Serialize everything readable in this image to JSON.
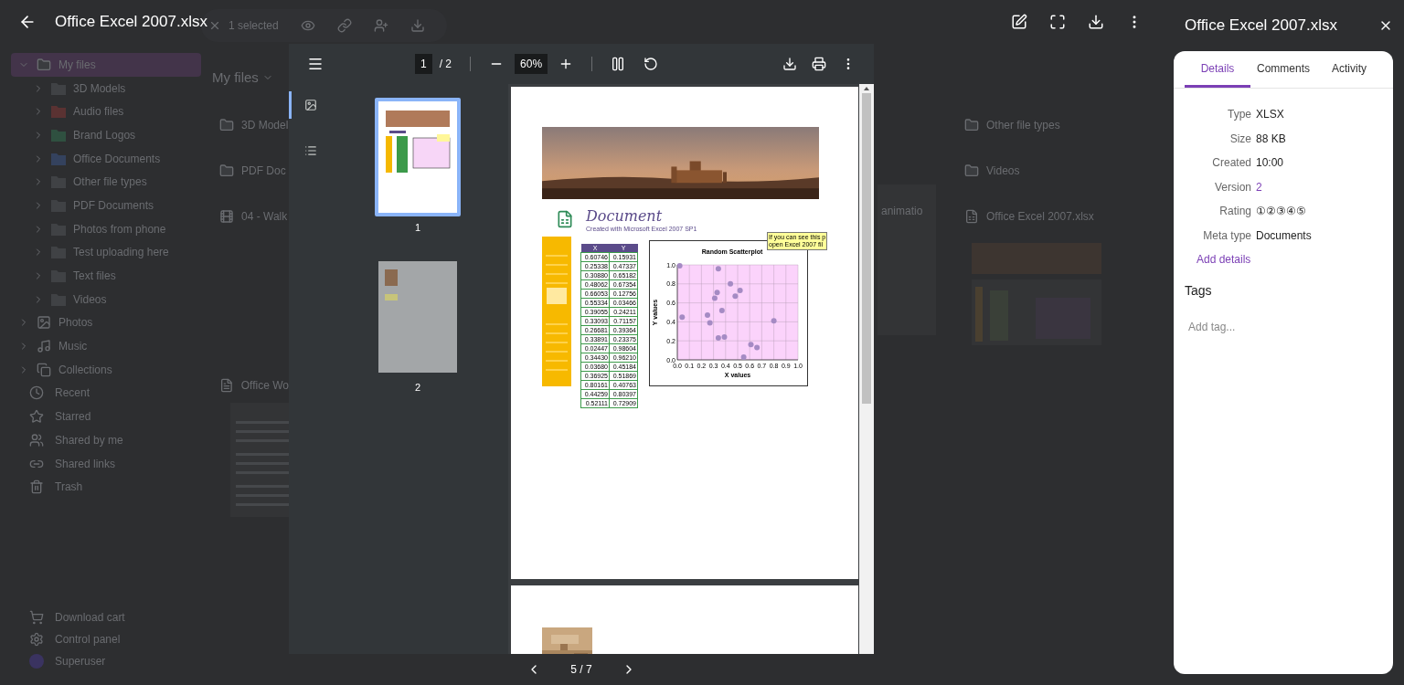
{
  "background": {
    "selection": {
      "label": "1 selected"
    },
    "breadcrumb": "My files",
    "tree": [
      {
        "label": "My files",
        "expanded": true,
        "selected": true,
        "children": [
          {
            "label": "3D Models",
            "color": "#404245"
          },
          {
            "label": "Audio files",
            "color": "#5a3232"
          },
          {
            "label": "Brand Logos",
            "color": "#2f5040"
          },
          {
            "label": "Office Documents",
            "color": "#34425e"
          },
          {
            "label": "Other file types",
            "color": "#404245"
          },
          {
            "label": "PDF Documents",
            "color": "#404245"
          },
          {
            "label": "Photos from phone",
            "color": "#404245"
          },
          {
            "label": "Test uploading here",
            "color": "#404245"
          },
          {
            "label": "Text files",
            "color": "#404245"
          },
          {
            "label": "Videos",
            "color": "#404245"
          }
        ]
      },
      {
        "label": "Photos",
        "kind": "photos",
        "expanded": false
      },
      {
        "label": "Music",
        "kind": "music",
        "expanded": false
      },
      {
        "label": "Collections",
        "kind": "collections",
        "expanded": false
      }
    ],
    "nav": [
      {
        "label": "Recent",
        "kind": "recent"
      },
      {
        "label": "Starred",
        "kind": "starred"
      },
      {
        "label": "Shared by me",
        "kind": "shared"
      },
      {
        "label": "Shared links",
        "kind": "links"
      },
      {
        "label": "Trash",
        "kind": "trash"
      }
    ],
    "footer": [
      {
        "label": "Download cart",
        "kind": "cart"
      },
      {
        "label": "Control panel",
        "kind": "panel"
      },
      {
        "label": "Superuser",
        "kind": "user"
      }
    ],
    "files_left": [
      {
        "name": "3D Model",
        "kind": "folder"
      },
      {
        "name": "PDF Doc",
        "kind": "folder"
      },
      {
        "name": "04 - Walk",
        "kind": "video"
      },
      {
        "name": "Office Wo",
        "kind": "document"
      }
    ],
    "files_middle": [
      {
        "name": "animatio"
      }
    ],
    "files_right": [
      {
        "name": "Other file types",
        "kind": "folder"
      },
      {
        "name": "Videos",
        "kind": "folder"
      },
      {
        "name": "Office Excel 2007.xlsx",
        "kind": "spreadsheet"
      }
    ]
  },
  "viewer": {
    "title": "Office Excel 2007.xlsx",
    "toolbar": {
      "page": "1",
      "total": "/ 2",
      "zoom": "60%"
    },
    "sidebar_tabs": [
      {
        "kind": "thumbnails",
        "selected": true
      },
      {
        "kind": "outline",
        "selected": false
      }
    ],
    "thumbnails": [
      {
        "label": "1",
        "selected": true
      },
      {
        "label": "2",
        "selected": false
      }
    ],
    "document": {
      "heading": "Document",
      "subtitle": "Created with Microsoft Excel 2007 SP1",
      "table": {
        "columns": [
          "X",
          "Y"
        ],
        "rows": [
          [
            "0.60746",
            "0.15931"
          ],
          [
            "0.25338",
            "0.47337"
          ],
          [
            "0.30880",
            "0.65182"
          ],
          [
            "0.48062",
            "0.67354"
          ],
          [
            "0.66053",
            "0.12756"
          ],
          [
            "0.55334",
            "0.03466"
          ],
          [
            "0.39055",
            "0.24211"
          ],
          [
            "0.33093",
            "0.71157"
          ],
          [
            "0.26681",
            "0.39364"
          ],
          [
            "0.33891",
            "0.23375"
          ],
          [
            "0.02447",
            "0.98604"
          ],
          [
            "0.34430",
            "0.96210"
          ],
          [
            "0.03680",
            "0.45184"
          ],
          [
            "0.36925",
            "0.51869"
          ],
          [
            "0.80161",
            "0.40763"
          ],
          [
            "0.44259",
            "0.80397"
          ],
          [
            "0.52111",
            "0.72909"
          ]
        ]
      },
      "note": [
        "If you can see this p",
        "open Excel 2007 fil"
      ],
      "chart_data": {
        "type": "scatter",
        "title": "Random Scatterplot",
        "xlabel": "X values",
        "ylabel": "Y values",
        "x": [
          0.61,
          0.25,
          0.31,
          0.48,
          0.66,
          0.55,
          0.39,
          0.33,
          0.27,
          0.34,
          0.02,
          0.34,
          0.04,
          0.37,
          0.8,
          0.44,
          0.52
        ],
        "series": [
          {
            "color": "#a58bc4",
            "values": [
              0.16,
              0.47,
              0.65,
              0.67,
              0.13,
              0.03,
              0.24,
              0.71,
              0.39,
              0.23,
              0.99,
              0.96,
              0.45,
              0.52,
              0.41,
              0.8,
              0.73
            ]
          }
        ],
        "xlim": [
          0,
          1
        ],
        "ylim": [
          0,
          1
        ],
        "grid": true,
        "xticks": [
          {
            "value": 0,
            "label": "0.0"
          },
          {
            "value": 0.1,
            "label": "0.1"
          },
          {
            "value": 0.2,
            "label": "0.2"
          },
          {
            "value": 0.3,
            "label": "0.3"
          },
          {
            "value": 0.4,
            "label": "0.4"
          },
          {
            "value": 0.5,
            "label": "0.5"
          },
          {
            "value": 0.6,
            "label": "0.6"
          },
          {
            "value": 0.7,
            "label": "0.7"
          },
          {
            "value": 0.8,
            "label": "0.8"
          },
          {
            "value": 0.9,
            "label": "0.9"
          },
          {
            "value": 1,
            "label": "1.0"
          }
        ],
        "yticks": [
          {
            "value": 0,
            "label": "0.0"
          },
          {
            "value": 0.2,
            "label": "0.2"
          },
          {
            "value": 0.4,
            "label": "0.4"
          },
          {
            "value": 0.6,
            "label": "0.6"
          },
          {
            "value": 0.8,
            "label": "0.8"
          },
          {
            "value": 1,
            "label": "1.0"
          }
        ]
      }
    },
    "pager": "5 / 7"
  },
  "details": {
    "title": "Office Excel 2007.xlsx",
    "tabs": [
      {
        "label": "Details",
        "selected": true
      },
      {
        "label": "Comments",
        "selected": false
      },
      {
        "label": "Activity",
        "selected": false
      }
    ],
    "fields": [
      {
        "label": "Type",
        "value": "XLSX",
        "kind": "text"
      },
      {
        "label": "Size",
        "value": "88 KB",
        "kind": "text"
      },
      {
        "label": "Created",
        "value": "10:00",
        "kind": "text"
      },
      {
        "label": "Version",
        "value": "2",
        "kind": "link"
      },
      {
        "label": "Rating",
        "value": "①②③④⑤",
        "kind": "text"
      },
      {
        "label": "Meta type",
        "value": "Documents",
        "kind": "text"
      }
    ],
    "add_details": "Add details",
    "tags_heading": "Tags",
    "tag_input": {
      "placeholder": "Add tag..."
    }
  }
}
